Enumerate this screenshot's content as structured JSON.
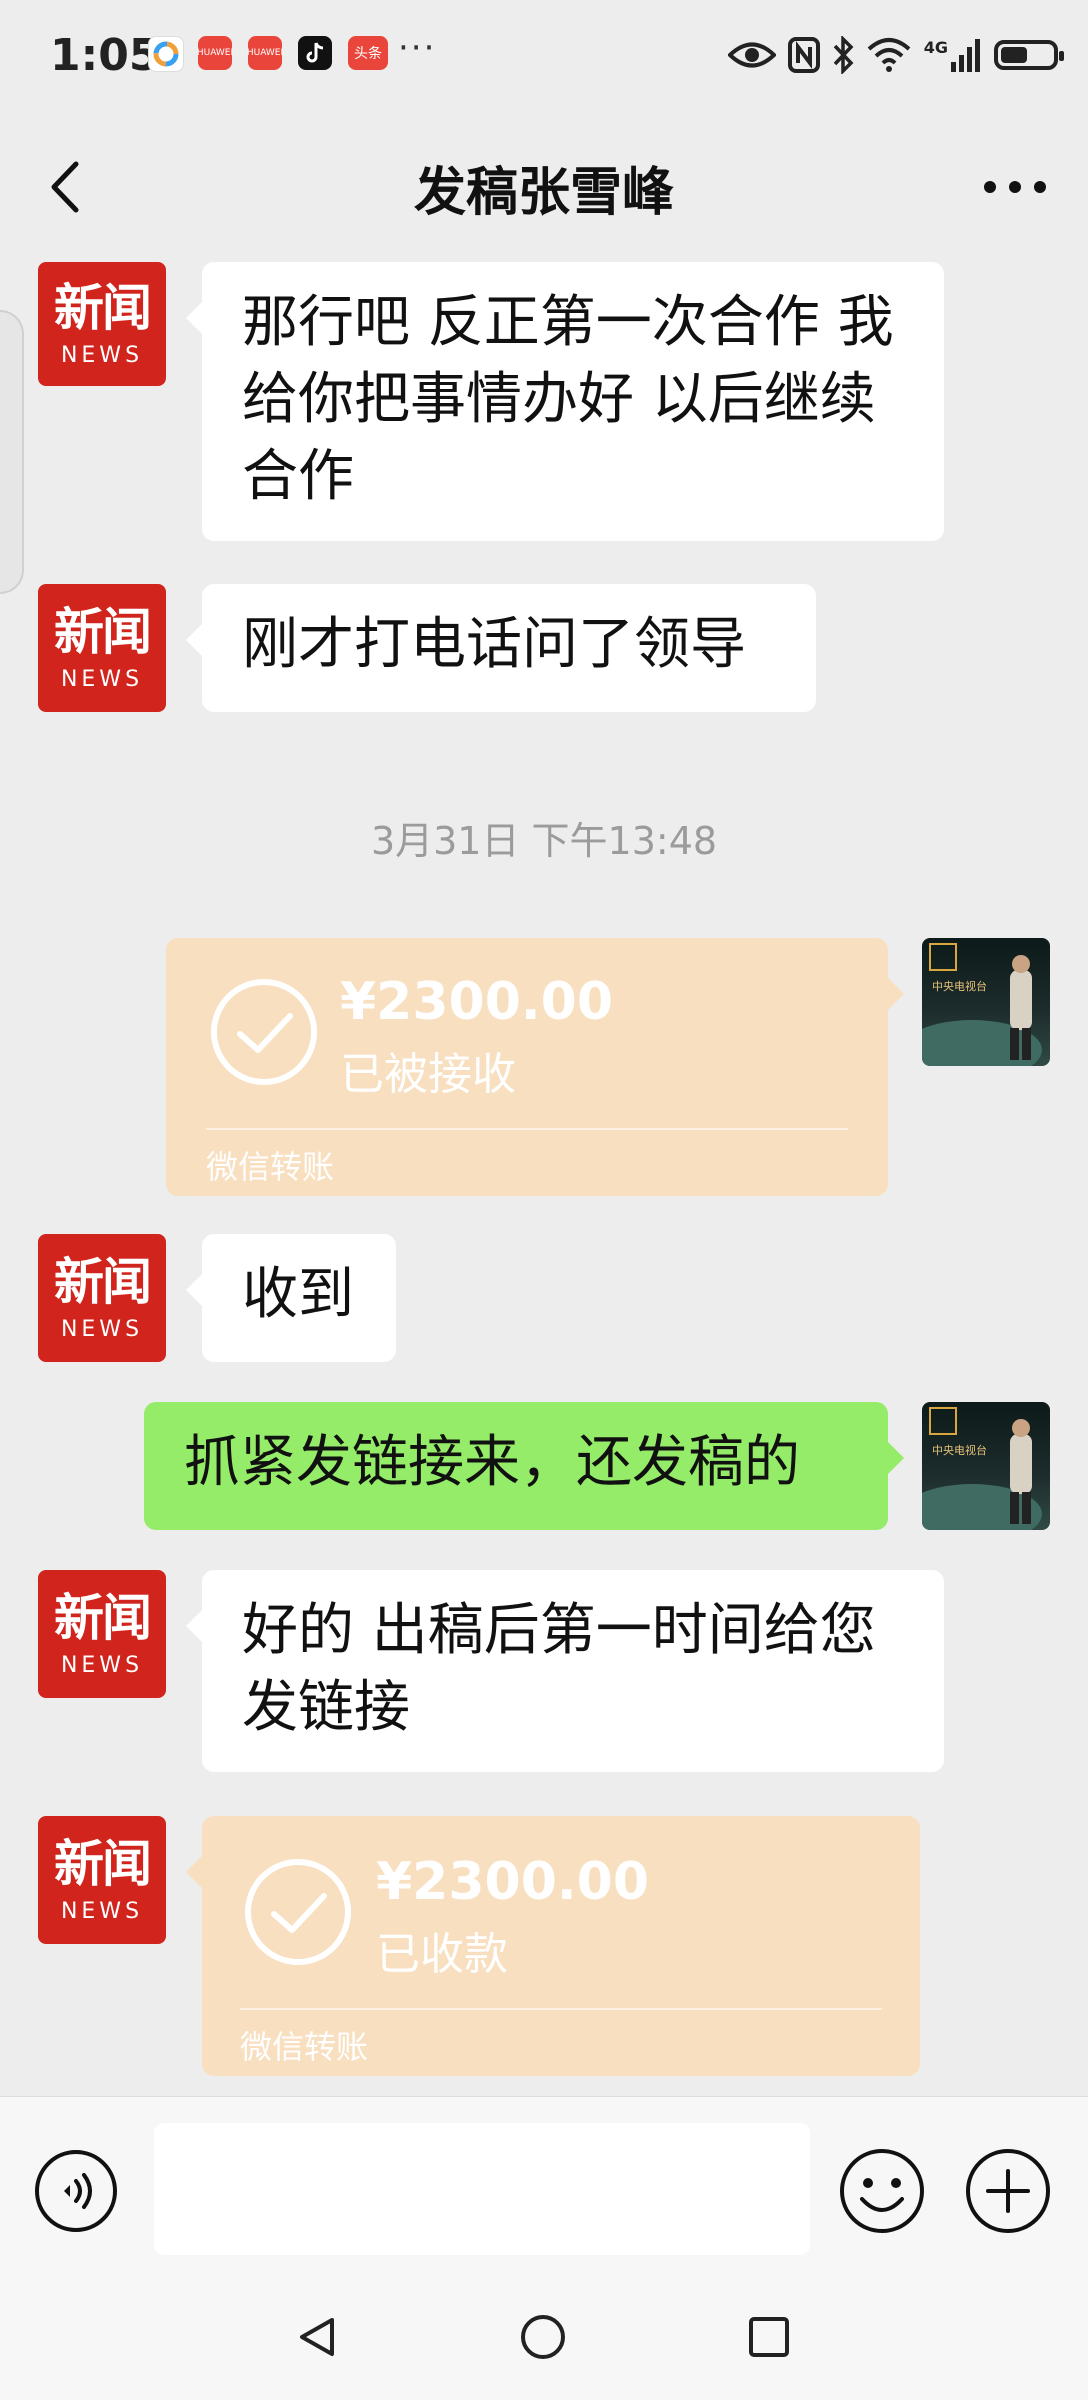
{
  "status_bar": {
    "time": "1:05",
    "notifications": [
      {
        "name": "app-icon-colorful",
        "color": "#ffffff"
      },
      {
        "name": "huawei-icon",
        "label": "HUAWEI",
        "color": "#e9453a"
      },
      {
        "name": "huawei-icon",
        "label": "HUAWEI",
        "color": "#e9453a"
      },
      {
        "name": "tiktok-icon",
        "color": "#111111"
      },
      {
        "name": "toutiao-icon",
        "label": "头条",
        "color": "#e9453a"
      }
    ],
    "overflow": "···",
    "network": "4G"
  },
  "header": {
    "title": "发稿张雪峰"
  },
  "messages": [
    {
      "type": "text",
      "side": "left",
      "text_lines": [
        "那行吧 反正第一次合作 我",
        "给你把事情办好 以后继续",
        "合作"
      ]
    },
    {
      "type": "text",
      "side": "left",
      "text_lines": [
        "刚才打电话问了领导"
      ]
    },
    {
      "type": "time",
      "text": "3月31日 下午13:48"
    },
    {
      "type": "transfer",
      "side": "right",
      "amount": "¥2300.00",
      "status": "已被接收",
      "label": "微信转账"
    },
    {
      "type": "text",
      "side": "left",
      "text_lines": [
        "收到"
      ]
    },
    {
      "type": "text",
      "side": "right",
      "text_lines": [
        "抓紧发链接来，还发稿的"
      ]
    },
    {
      "type": "text",
      "side": "left",
      "text_lines": [
        "好的 出稿后第一时间给您",
        "发链接"
      ]
    },
    {
      "type": "transfer",
      "side": "left",
      "amount": "¥2300.00",
      "status": "已收款",
      "label": "微信转账"
    }
  ],
  "avatar": {
    "news_big": "新闻",
    "news_small": "NEWS"
  },
  "input": {
    "placeholder": ""
  },
  "colors": {
    "background": "#ededed",
    "green_bubble": "#95ec69",
    "transfer": "#f8dfc0",
    "news_red": "#d0241c"
  }
}
